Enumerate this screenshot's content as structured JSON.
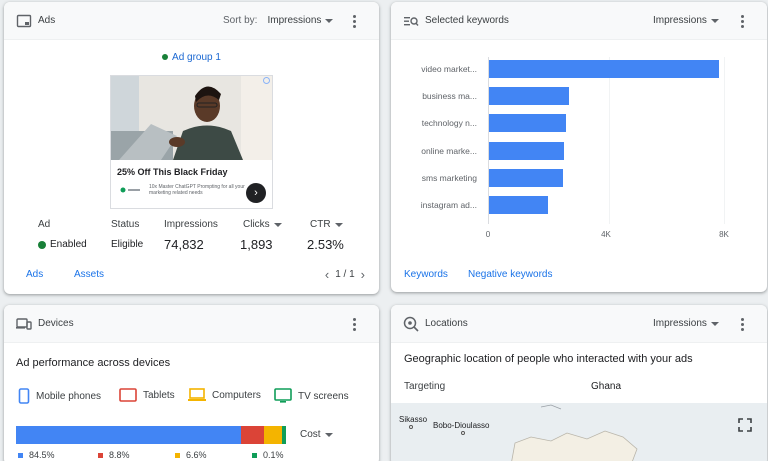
{
  "ads_card": {
    "title": "Ads",
    "sort_label": "Sort by:",
    "sort_value": "Impressions",
    "ad_group": "Ad group 1",
    "ad_preview": {
      "headline": "25% Off This Black Friday",
      "description": "10x Master ChatGPT Prompting for all your marketing related needs"
    },
    "stats": {
      "ad_label": "Ad",
      "ad_value": "Enabled",
      "status_label": "Status",
      "status_value": "Eligible",
      "impressions_label": "Impressions",
      "impressions_value": "74,832",
      "clicks_label": "Clicks",
      "clicks_value": "1,893",
      "ctr_label": "CTR",
      "ctr_value": "2.53%"
    },
    "links": {
      "ads": "Ads",
      "assets": "Assets"
    },
    "pager": "1 / 1"
  },
  "keywords_card": {
    "title": "Selected keywords",
    "metric": "Impressions",
    "links": {
      "keywords": "Keywords",
      "negative": "Negative keywords"
    }
  },
  "chart_data": {
    "type": "bar",
    "orientation": "horizontal",
    "categories": [
      "video market...",
      "business ma...",
      "technology n...",
      "online marke...",
      "sms marketing",
      "instagram ad..."
    ],
    "values": [
      7800,
      2700,
      2600,
      2550,
      2500,
      2000
    ],
    "x_ticks": [
      "0",
      "4K",
      "8K"
    ],
    "xlim": [
      0,
      8000
    ],
    "color": "#4285f4"
  },
  "devices_card": {
    "title": "Devices",
    "section_title": "Ad performance across devices",
    "legend": [
      {
        "label": "Mobile phones",
        "color": "#4285f4"
      },
      {
        "label": "Tablets",
        "color": "#db4437"
      },
      {
        "label": "Computers",
        "color": "#f4b400"
      },
      {
        "label": "TV screens",
        "color": "#0f9d58"
      }
    ],
    "shares": [
      {
        "pct": 84.5,
        "label": "84.5%",
        "color": "#4285f4"
      },
      {
        "pct": 8.8,
        "label": "8.8%",
        "color": "#db4437"
      },
      {
        "pct": 6.6,
        "label": "6.6%",
        "color": "#f4b400"
      },
      {
        "pct": 0.1,
        "label": "0.1%",
        "color": "#0f9d58"
      }
    ],
    "metric": "Cost"
  },
  "locations_card": {
    "title": "Locations",
    "metric": "Impressions",
    "section_title": "Geographic location of people who interacted with your ads",
    "targeting_label": "Targeting",
    "targeting_value": "Ghana",
    "map_places": [
      "Sikasso",
      "Bobo-Dioulasso"
    ]
  }
}
